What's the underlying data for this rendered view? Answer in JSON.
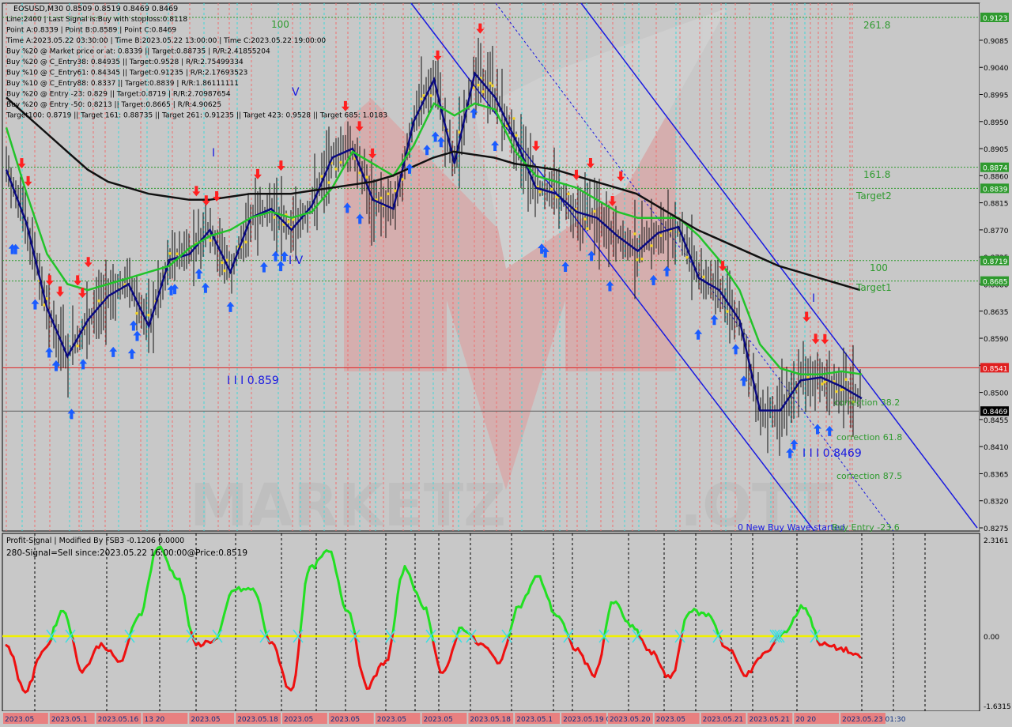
{
  "header": {
    "symbol_line": "EOSUSD,M30  0.8509 0.8519 0.8469 0.8469",
    "info_lines": [
      "Line:2400 | Last Signal is:Buy with stoploss:0.8118",
      "Point A:0.8339 | Point B:0.8589 | Point C:0.8469",
      "Time A:2023.05.22 03:30:00 | Time B:2023.05.22 13:00:00 | Time C:2023.05.22 19:00:00",
      "Buy %20 @ Market price or at: 0.8339 || Target:0.88735 | R/R:2.41855204",
      "Buy %20 @ C_Entry38: 0.84935 || Target:0.9528 | R/R:2.75499334",
      "Buy %10 @ C_Entry61: 0.84345 || Target:0.91235 | R/R:2.17693523",
      "Buy %10 @ C_Entry88: 0.8337 || Target:0.8839 | R/R:1.86111111",
      "Buy %20 @ Entry -23: 0.829 || Target:0.8719 | R/R:2.70987654",
      "Buy %20 @ Entry -50: 0.8213 || Target:0.8665 | R/R:4.90625",
      "Target100: 0.8719 || Target 161: 0.88735 || Target 261: 0.91235 || Target 423: 0.9528 || Target 685: 1.0183"
    ]
  },
  "annotations": {
    "wave_label": "I I I 0.859",
    "wave_label2": "I I I 0.8469",
    "roman_v": "V",
    "roman_iv": "I V",
    "roman_i": "I",
    "roman_i2": "I",
    "fib_100_top": "100",
    "fib_261": "261.8",
    "fib_161": "161.8",
    "target2": "Target2",
    "fib_100": "100",
    "target1": "Target1",
    "corr38": "correction 38.2",
    "corr61": "correction 61.8",
    "corr87": "correction 87.5",
    "new_wave": "0 New Buy Wave started",
    "buy_entry": "Buy Entry -23.6"
  },
  "right_axis": {
    "ticks": [
      "0.9085",
      "0.9040",
      "0.8995",
      "0.8950",
      "0.8905",
      "0.8860",
      "0.8815",
      "0.8770",
      "0.8725",
      "0.8680",
      "0.8635",
      "0.8590",
      "0.8545",
      "0.8500",
      "0.8455",
      "0.8410",
      "0.8365",
      "0.8320",
      "0.8275"
    ],
    "tags": [
      {
        "text": "0.9123",
        "color": "#2e9a2e"
      },
      {
        "text": "0.8874",
        "color": "#2e9a2e"
      },
      {
        "text": "0.8839",
        "color": "#2e9a2e"
      },
      {
        "text": "0.8719",
        "color": "#2e9a2e"
      },
      {
        "text": "0.8685",
        "color": "#2e9a2e"
      },
      {
        "text": "0.8541",
        "color": "#e02020"
      },
      {
        "text": "0.8469",
        "color": "#000000"
      }
    ]
  },
  "subwindow": {
    "title": "Profit-Signal | Modified By FSB3 -0.1206 0.0000",
    "signal": "280-Signal=Sell since:2023.05.22 16:00:00@Price:0.8519",
    "ticks": [
      "2.3161",
      "0.00",
      "-1.6315"
    ]
  },
  "time_axis": {
    "labels": [
      "2023.05",
      "2023.05.1",
      "2023.05.16",
      "13 20",
      "2023.05",
      "2023.05.18",
      "2023.05",
      "2023.05",
      "2023.05",
      "2023.05",
      "2023.05.18",
      "2023.05.1",
      "2023.05.19 09:00",
      "2023.05.20",
      "2023.05",
      "2023.05.21",
      "2023.05.21",
      "20 20",
      "2023.05.23 01:30"
    ]
  },
  "colors": {
    "background": "#c8c8c8",
    "ema_green": "#22c32a",
    "ema_navy": "#0a0a80",
    "sma_black": "#111111",
    "channel": "#1a1ae0",
    "signal_up": "#1a5cff",
    "signal_down": "#ff2020",
    "oscillator_up": "#22e022",
    "oscillator_down": "#ee1010",
    "zero_line": "#f0f000"
  },
  "chart_data": {
    "type": "line",
    "title": "EOSUSD,M30",
    "xlabel": "",
    "ylabel": "",
    "ylim": [
      0.825,
      0.915
    ],
    "price_levels": [
      0.9123,
      0.8874,
      0.8839,
      0.8719,
      0.8685,
      0.8541,
      0.8469
    ],
    "series": [
      {
        "name": "",
        "values": [
          0.887,
          0.878,
          0.864,
          0.856,
          0.862,
          0.866,
          0.868,
          0.861,
          0.872,
          0.873,
          0.877,
          0.87,
          0.879,
          0.8805,
          0.877,
          0.881,
          0.889,
          0.8905,
          0.882,
          0.8805,
          0.895,
          0.902,
          0.888,
          0.903,
          0.899,
          0.892,
          0.884,
          0.883,
          0.88,
          0.879,
          0.876,
          0.8735,
          0.8765,
          0.8775,
          0.869,
          0.867,
          0.862,
          0.847,
          0.847,
          0.852,
          0.8525,
          0.851,
          0.849
        ]
      },
      {
        "name": "",
        "values": [
          0.894,
          0.883,
          0.873,
          0.868,
          0.867,
          0.868,
          0.869,
          0.87,
          0.871,
          0.874,
          0.876,
          0.877,
          0.879,
          0.88,
          0.879,
          0.88,
          0.884,
          0.89,
          0.888,
          0.886,
          0.891,
          0.898,
          0.896,
          0.898,
          0.897,
          0.89,
          0.886,
          0.885,
          0.884,
          0.882,
          0.88,
          0.879,
          0.879,
          0.879,
          0.876,
          0.872,
          0.867,
          0.858,
          0.854,
          0.853,
          0.853,
          0.8535,
          0.853
        ]
      },
      {
        "name": "",
        "values": [
          0.899,
          0.896,
          0.893,
          0.89,
          0.887,
          0.885,
          0.884,
          0.883,
          0.8825,
          0.882,
          0.882,
          0.8825,
          0.883,
          0.883,
          0.883,
          0.8835,
          0.884,
          0.8845,
          0.885,
          0.886,
          0.8875,
          0.889,
          0.89,
          0.8895,
          0.889,
          0.888,
          0.8875,
          0.887,
          0.886,
          0.885,
          0.884,
          0.883,
          0.881,
          0.879,
          0.877,
          0.8755,
          0.874,
          0.8725,
          0.871,
          0.87,
          0.869,
          0.868,
          0.867
        ]
      }
    ],
    "oscillator": {
      "ylim": [
        -1.6315,
        2.3161
      ],
      "values": [
        -0.2,
        -1.3,
        -0.3,
        0.6,
        -0.8,
        -0.2,
        -0.6,
        0.5,
        2.1,
        1.4,
        -0.2,
        -0.1,
        1.1,
        1.1,
        -0.2,
        -1.3,
        1.6,
        2.0,
        0.6,
        -1.2,
        -0.6,
        1.6,
        0.7,
        -0.9,
        0.2,
        -0.2,
        -0.6,
        0.7,
        1.4,
        0.5,
        -0.3,
        -0.9,
        0.8,
        0.2,
        -0.4,
        -1.0,
        0.6,
        0.5,
        -0.3,
        -0.9,
        -0.4,
        0.1,
        0.7,
        -0.2,
        -0.3,
        -0.5
      ]
    }
  }
}
